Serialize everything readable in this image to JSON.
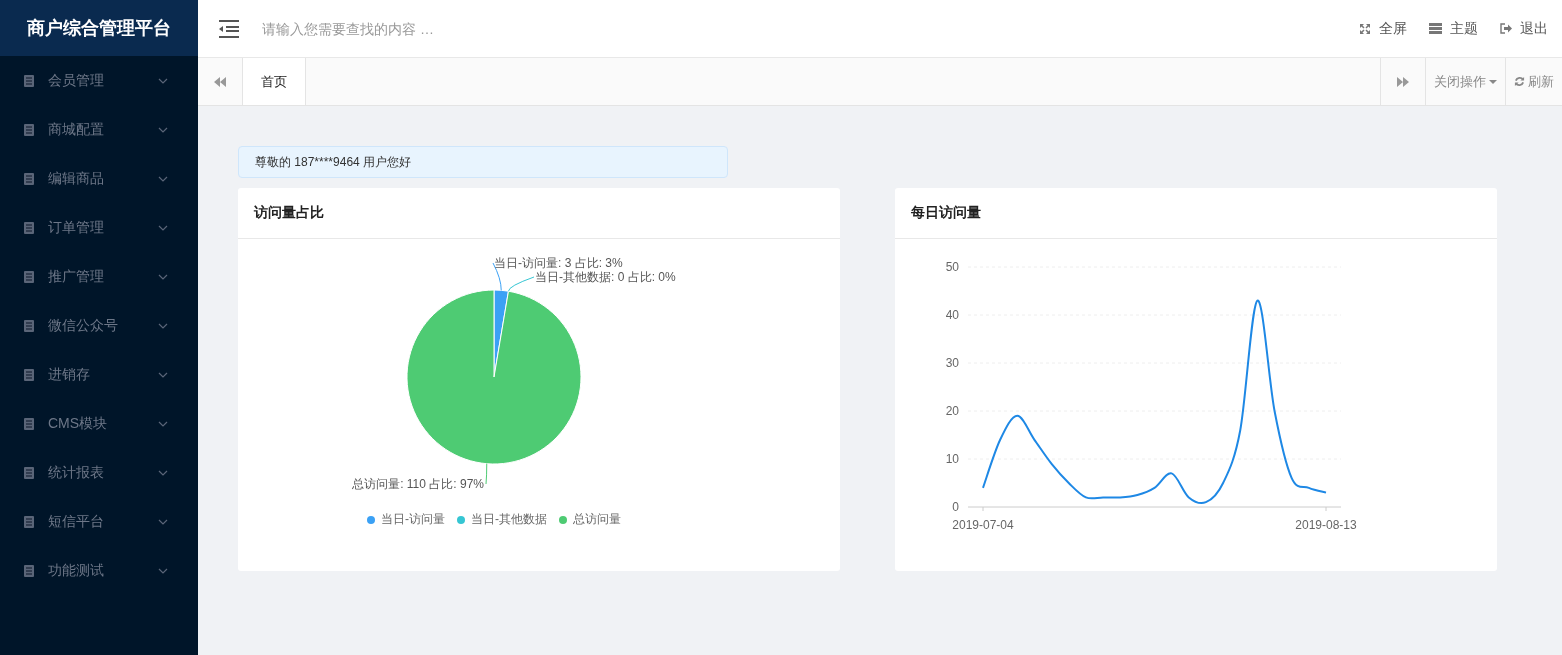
{
  "sidebar": {
    "title": "商户综合管理平台",
    "items": [
      {
        "label": "会员管理",
        "expanded": false
      },
      {
        "label": "商城配置",
        "expanded": false
      },
      {
        "label": "编辑商品",
        "expanded": false
      },
      {
        "label": "订单管理",
        "expanded": false
      },
      {
        "label": "推广管理",
        "expanded": false
      },
      {
        "label": "微信公众号",
        "expanded": false
      },
      {
        "label": "进销存",
        "expanded": false
      },
      {
        "label": "CMS模块",
        "expanded": false
      },
      {
        "label": "统计报表",
        "expanded": false
      },
      {
        "label": "短信平台",
        "expanded": false
      },
      {
        "label": "功能测试",
        "expanded": false
      }
    ]
  },
  "header": {
    "search": {
      "placeholder": "请输入您需要查找的内容 …"
    },
    "actions": [
      {
        "kind": "fullscreen",
        "label": "全屏"
      },
      {
        "kind": "theme",
        "label": "主题"
      },
      {
        "kind": "logout",
        "label": "退出"
      }
    ]
  },
  "tabbar": {
    "tabs": [
      {
        "label": "首页",
        "selected": true
      }
    ],
    "close_menu": "关闭操作",
    "refresh": "刷新"
  },
  "greeting": "尊敬的 187****9464 用户您好",
  "cards": [
    {
      "title": "访问量占比",
      "chart_data": {
        "type": "pie",
        "categories": [
          "当日-访问量",
          "当日-其他数据",
          "总访问量"
        ],
        "values": [
          3,
          0,
          110
        ],
        "value_labels": [
          "当日-访问量: 3 占比: 3%",
          "当日-其他数据: 0 占比: 0%",
          "总访问量: 110 占比: 97%"
        ]
      }
    },
    {
      "title": "每日访问量",
      "chart_data": {
        "type": "line",
        "categories": [
          "2019-07-04",
          null,
          null,
          null,
          null,
          null,
          null,
          null,
          null,
          null,
          null,
          null,
          null,
          null,
          null,
          null,
          null,
          null,
          null,
          null,
          "2019-08-13"
        ],
        "series": [
          {
            "color": "#1e88e5",
            "values": [
              4,
              14,
              19,
              14,
              9,
              5,
              2,
              2,
              2,
              2.5,
              4,
              7,
              2,
              1,
              5,
              16,
              43,
              20,
              6,
              4,
              3
            ]
          }
        ],
        "grid": true,
        "ylim": [
          0,
          50
        ],
        "yticks": [
          0,
          10,
          20,
          30,
          40,
          50
        ]
      }
    }
  ]
}
